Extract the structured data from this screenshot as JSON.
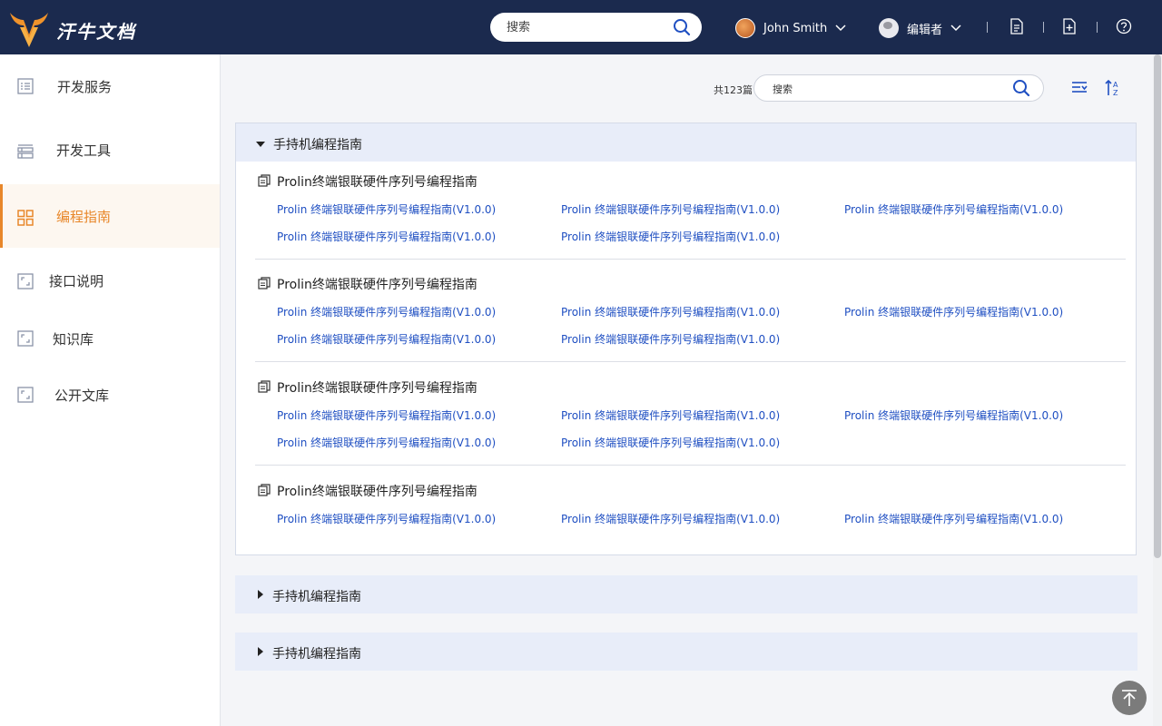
{
  "header": {
    "brand": "汗牛文档",
    "search_placeholder": "搜索",
    "user_name": "John Smith",
    "role": "编辑者"
  },
  "sidebar": {
    "items": [
      {
        "label": "开发服务",
        "icon": "list-icon"
      },
      {
        "label": "开发工具",
        "icon": "table-list-icon"
      },
      {
        "label": "编程指南",
        "icon": "grid-icon",
        "active": true
      },
      {
        "label": "接口说明",
        "icon": "frame-icon"
      },
      {
        "label": "知识库",
        "icon": "frame-icon"
      },
      {
        "label": "公开文库",
        "icon": "frame-icon"
      }
    ]
  },
  "main": {
    "count": "共123篇",
    "search_placeholder": "搜索",
    "expanded_section": {
      "title": "手持机编程指南",
      "groups": [
        {
          "title": "Prolin终端银联硬件序列号编程指南",
          "links": [
            "Prolin 终端银联硬件序列号编程指南(V1.0.0)",
            "Prolin 终端银联硬件序列号编程指南(V1.0.0)",
            "Prolin 终端银联硬件序列号编程指南(V1.0.0)",
            "Prolin 终端银联硬件序列号编程指南(V1.0.0)",
            "Prolin 终端银联硬件序列号编程指南(V1.0.0)"
          ]
        },
        {
          "title": "Prolin终端银联硬件序列号编程指南",
          "links": [
            "Prolin 终端银联硬件序列号编程指南(V1.0.0)",
            "Prolin 终端银联硬件序列号编程指南(V1.0.0)",
            "Prolin 终端银联硬件序列号编程指南(V1.0.0)",
            "Prolin 终端银联硬件序列号编程指南(V1.0.0)",
            "Prolin 终端银联硬件序列号编程指南(V1.0.0)"
          ]
        },
        {
          "title": "Prolin终端银联硬件序列号编程指南",
          "links": [
            "Prolin 终端银联硬件序列号编程指南(V1.0.0)",
            "Prolin 终端银联硬件序列号编程指南(V1.0.0)",
            "Prolin 终端银联硬件序列号编程指南(V1.0.0)",
            "Prolin 终端银联硬件序列号编程指南(V1.0.0)",
            "Prolin 终端银联硬件序列号编程指南(V1.0.0)"
          ]
        },
        {
          "title": "Prolin终端银联硬件序列号编程指南",
          "links": [
            "Prolin 终端银联硬件序列号编程指南(V1.0.0)",
            "Prolin 终端银联硬件序列号编程指南(V1.0.0)",
            "Prolin 终端银联硬件序列号编程指南(V1.0.0)"
          ]
        }
      ]
    },
    "collapsed_sections": [
      {
        "title": "手持机编程指南"
      },
      {
        "title": "手持机编程指南"
      }
    ]
  },
  "colors": {
    "topbar": "#1b2a4e",
    "accent": "#e8872a",
    "link": "#1f4fc2",
    "section_header": "#e8edf9"
  }
}
